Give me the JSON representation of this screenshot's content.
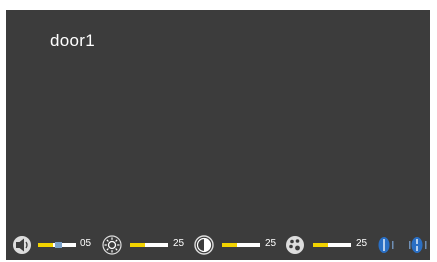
{
  "camera": {
    "name": "door1"
  },
  "controls": {
    "volume": {
      "value": "05",
      "level": 0.4,
      "icon": "speaker-icon"
    },
    "brightness": {
      "value": "25",
      "level": 0.4,
      "icon": "sun-icon"
    },
    "contrast": {
      "value": "25",
      "level": 0.4,
      "icon": "contrast-icon"
    },
    "color": {
      "value": "25",
      "level": 0.4,
      "icon": "palette-icon"
    }
  },
  "navigation": {
    "icons": [
      "previous-icon",
      "next-icon"
    ]
  },
  "colors": {
    "screen": "#3c3c3c",
    "fill": "#f2d300",
    "track": "#ffffff",
    "accent": "#2a6fc4"
  }
}
